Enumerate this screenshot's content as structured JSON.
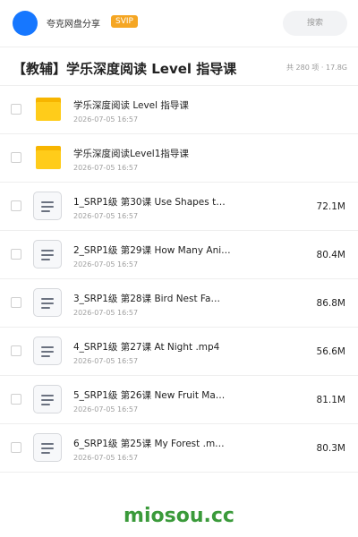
{
  "header": {
    "app_name": "夸克网盘分享",
    "badge": "SVIP",
    "search_label": "搜索",
    "avatar_color": "#1677ff",
    "badge_color": "#f5a623"
  },
  "folder": {
    "title": "【教辅】学乐深度阅读 Level 指导课",
    "summary": "共 280 项 · 17.8G"
  },
  "items": [
    {
      "type": "folder",
      "icon": "folder-icon",
      "name": "学乐深度阅读 Level 指导课",
      "date": "2026-07-05 16:57",
      "size": ""
    },
    {
      "type": "folder",
      "icon": "folder-icon",
      "name": "学乐深度阅读Level1指导课",
      "date": "2026-07-05 16:57",
      "size": ""
    },
    {
      "type": "file",
      "icon": "video-file-icon",
      "name": "1_SRP1级 第30课 Use Shapes t…",
      "date": "2026-07-05 16:57",
      "size": "72.1M"
    },
    {
      "type": "file",
      "icon": "video-file-icon",
      "name": "2_SRP1级 第29课 How Many Ani…",
      "date": "2026-07-05 16:57",
      "size": "80.4M"
    },
    {
      "type": "file",
      "icon": "video-file-icon",
      "name": "3_SRP1级 第28课 Bird Nest Fa…",
      "date": "2026-07-05 16:57",
      "size": "86.8M"
    },
    {
      "type": "file",
      "icon": "video-file-icon",
      "name": "4_SRP1级 第27课 At Night .mp4",
      "date": "2026-07-05 16:57",
      "size": "56.6M"
    },
    {
      "type": "file",
      "icon": "video-file-icon",
      "name": "5_SRP1级 第26课 New Fruit Ma…",
      "date": "2026-07-05 16:57",
      "size": "81.1M"
    },
    {
      "type": "file",
      "icon": "video-file-icon",
      "name": "6_SRP1级 第25课 My Forest .m…",
      "date": "2026-07-05 16:57",
      "size": "80.3M"
    }
  ],
  "watermark": "miosou.cc"
}
